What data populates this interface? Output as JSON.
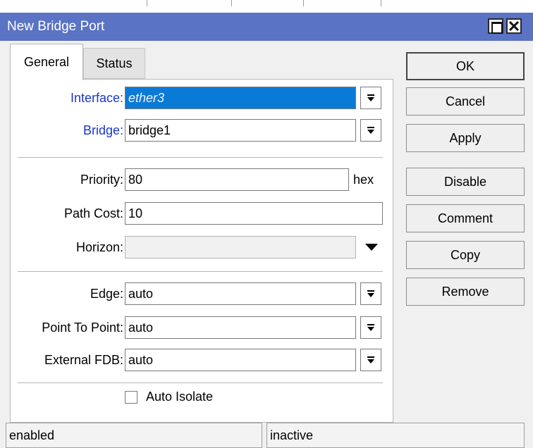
{
  "window": {
    "title": "New Bridge Port"
  },
  "tabs": [
    {
      "label": "General"
    },
    {
      "label": "Status"
    }
  ],
  "form": {
    "interface": {
      "label": "Interface:",
      "value": "ether3"
    },
    "bridge": {
      "label": "Bridge:",
      "value": "bridge1"
    },
    "priority": {
      "label": "Priority:",
      "value": "80",
      "suffix": "hex"
    },
    "path_cost": {
      "label": "Path Cost:",
      "value": "10"
    },
    "horizon": {
      "label": "Horizon:",
      "value": ""
    },
    "edge": {
      "label": "Edge:",
      "value": "auto"
    },
    "point_to_point": {
      "label": "Point To Point:",
      "value": "auto"
    },
    "external_fdb": {
      "label": "External FDB:",
      "value": "auto"
    },
    "auto_isolate": {
      "label": "Auto Isolate",
      "checked": false
    }
  },
  "buttons": {
    "ok": "OK",
    "cancel": "Cancel",
    "apply": "Apply",
    "disable": "Disable",
    "comment": "Comment",
    "copy": "Copy",
    "remove": "Remove"
  },
  "statusbar": {
    "left": "enabled",
    "right": "inactive"
  },
  "colors": {
    "titlebar": "#5a73c4",
    "label_accent": "#1a36c8",
    "selection": "#0a7ad7"
  }
}
